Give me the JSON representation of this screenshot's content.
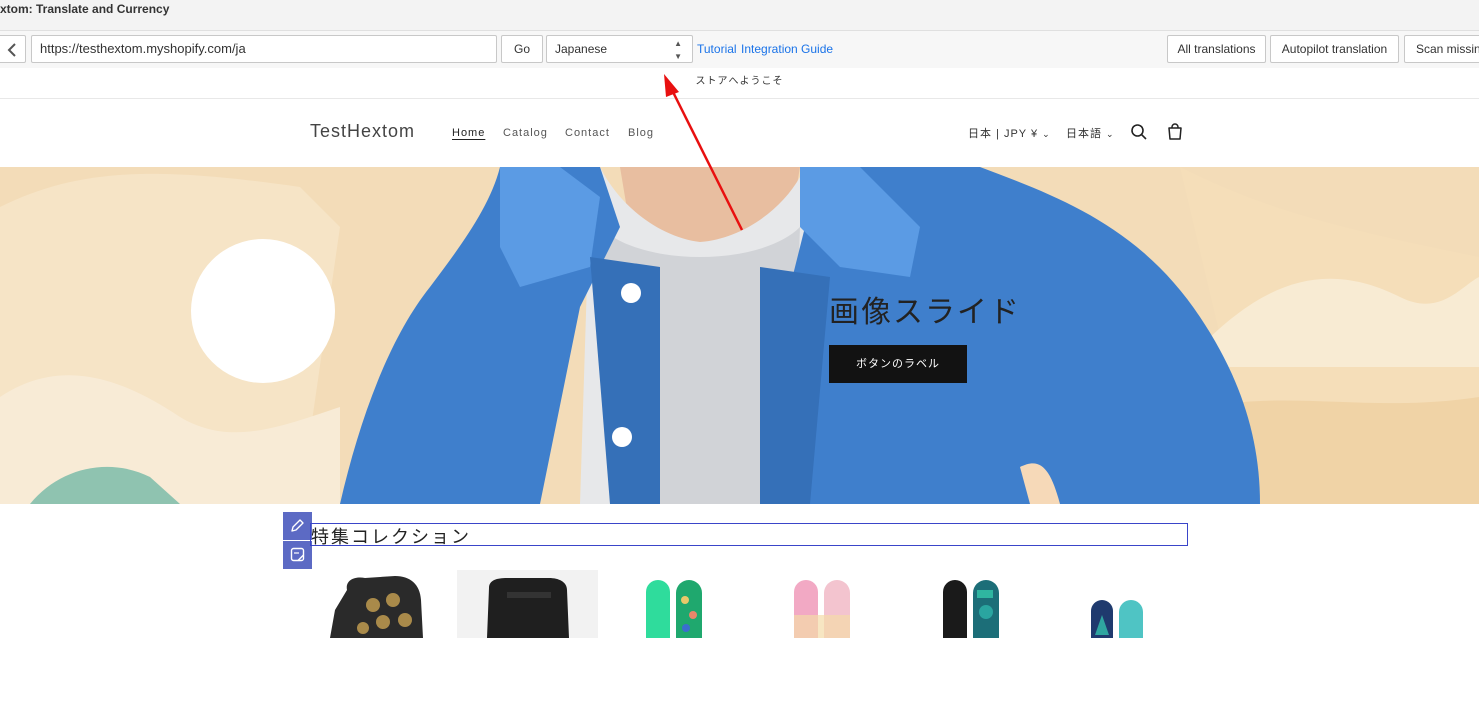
{
  "window": {
    "title": "xtom: Translate and Currency"
  },
  "toolbar": {
    "url": "https://testhextom.myshopify.com/ja",
    "go_label": "Go",
    "language_selected": "Japanese",
    "tutorial_link": "Tutorial",
    "integration_link": "Integration Guide",
    "all_translations_label": "All translations",
    "autopilot_label": "Autopilot translation",
    "scan_missing_label": "Scan missing"
  },
  "store": {
    "announcement": "ストアへようこそ",
    "logo": "TestHextom",
    "nav": [
      "Home",
      "Catalog",
      "Contact",
      "Blog"
    ],
    "country_selector": "日本 | JPY ¥",
    "language_selector": "日本語"
  },
  "hero": {
    "heading": "画像スライド",
    "button_label": "ボタンのラベル"
  },
  "collection": {
    "title": "特集コレクション"
  },
  "colors": {
    "accent": "#5c6ac4",
    "link": "#1a73e8",
    "annotation_arrow": "#e81010",
    "hero_background": "#f3dcb8",
    "jacket": "#3f7fcc"
  }
}
